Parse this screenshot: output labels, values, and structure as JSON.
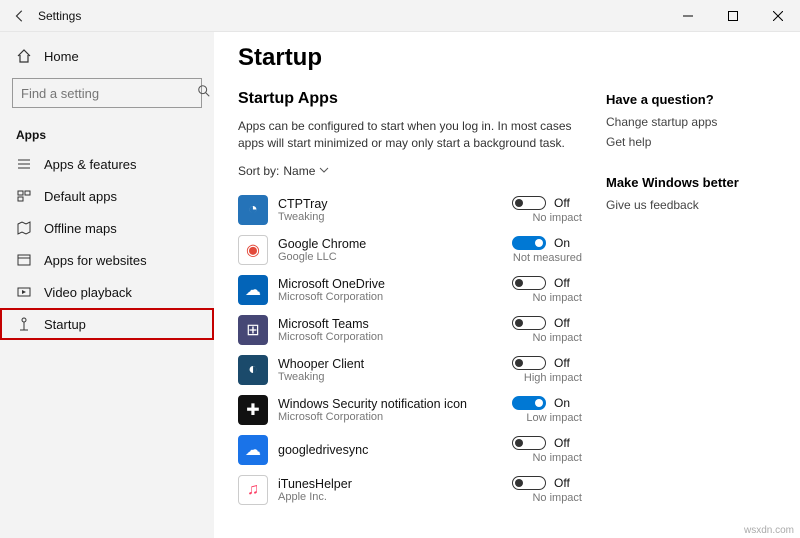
{
  "titlebar": {
    "title": "Settings"
  },
  "sidebar": {
    "home": "Home",
    "search_placeholder": "Find a setting",
    "section": "Apps",
    "items": [
      {
        "label": "Apps & features"
      },
      {
        "label": "Default apps"
      },
      {
        "label": "Offline maps"
      },
      {
        "label": "Apps for websites"
      },
      {
        "label": "Video playback"
      },
      {
        "label": "Startup"
      }
    ]
  },
  "main": {
    "title": "Startup",
    "subtitle": "Startup Apps",
    "description": "Apps can be configured to start when you log in. In most cases apps will start minimized or may only start a background task.",
    "sort_label": "Sort by:",
    "sort_value": "Name",
    "on_label": "On",
    "off_label": "Off",
    "apps": [
      {
        "name": "CTPTray",
        "publisher": "Tweaking",
        "on": false,
        "impact": "No impact",
        "icon_bg": "#2573b8",
        "glyph": "◔"
      },
      {
        "name": "Google Chrome",
        "publisher": "Google LLC",
        "on": true,
        "impact": "Not measured",
        "icon_bg": "#ffffff",
        "glyph": "◉",
        "glyph_color": "#e24a3b"
      },
      {
        "name": "Microsoft OneDrive",
        "publisher": "Microsoft Corporation",
        "on": false,
        "impact": "No impact",
        "icon_bg": "#0364b8",
        "glyph": "☁"
      },
      {
        "name": "Microsoft Teams",
        "publisher": "Microsoft Corporation",
        "on": false,
        "impact": "No impact",
        "icon_bg": "#464775",
        "glyph": "⊞"
      },
      {
        "name": "Whooper Client",
        "publisher": "Tweaking",
        "on": false,
        "impact": "High impact",
        "icon_bg": "#1b4a6b",
        "glyph": "◐"
      },
      {
        "name": "Windows Security notification icon",
        "publisher": "Microsoft Corporation",
        "on": true,
        "impact": "Low impact",
        "icon_bg": "#111111",
        "glyph": "✚"
      },
      {
        "name": "googledrivesync",
        "publisher": "",
        "on": false,
        "impact": "No impact",
        "icon_bg": "#1a73e8",
        "glyph": "☁"
      },
      {
        "name": "iTunesHelper",
        "publisher": "Apple Inc.",
        "on": false,
        "impact": "No impact",
        "icon_bg": "#ffffff",
        "glyph": "♫",
        "glyph_color": "#fc3c63"
      }
    ]
  },
  "aside": {
    "q_head": "Have a question?",
    "q_links": [
      "Change startup apps",
      "Get help"
    ],
    "f_head": "Make Windows better",
    "f_links": [
      "Give us feedback"
    ]
  },
  "watermark": "wsxdn.com"
}
